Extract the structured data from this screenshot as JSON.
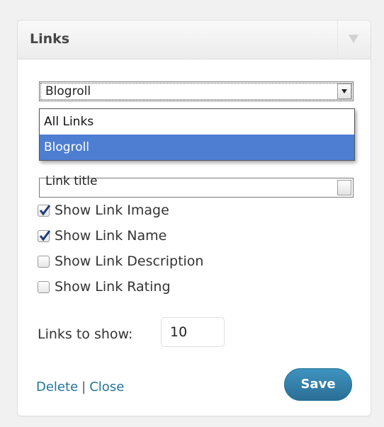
{
  "widget": {
    "title": "Links"
  },
  "category_select": {
    "selected": "Blogroll",
    "options": [
      "All Links",
      "Blogroll"
    ]
  },
  "orderby_select": {
    "selected": "Link title"
  },
  "checkboxes": [
    {
      "label": "Show Link Image",
      "checked": true
    },
    {
      "label": "Show Link Name",
      "checked": true
    },
    {
      "label": "Show Link Description",
      "checked": false
    },
    {
      "label": "Show Link Rating",
      "checked": false
    }
  ],
  "links_to_show": {
    "label": "Links to show:",
    "value": "10"
  },
  "footer": {
    "delete_label": "Delete",
    "separator": "|",
    "close_label": "Close",
    "save_label": "Save"
  },
  "colors": {
    "link": "#21759b",
    "highlight": "#4d7ed2",
    "save_button": "#2a6e95"
  }
}
